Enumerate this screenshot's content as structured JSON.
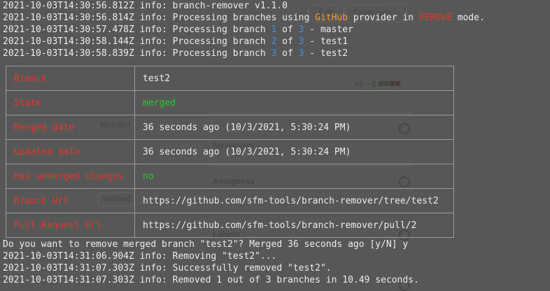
{
  "background_ui": {
    "edit": "Edit",
    "open_with": "Open with",
    "diff_added": "+2",
    "diff_removed": "−2",
    "member": "Member",
    "no_reviews": "No reviews",
    "assignees": "Assignees",
    "verified": "Verified",
    "labels": "Labels"
  },
  "log_lines": [
    {
      "ts": "2021-10-03T14:30:56.812Z",
      "prefix": " info: branch-remover v1.1.0"
    },
    {
      "ts": "2021-10-03T14:30:56.814Z",
      "prefix": " info: Processing branches using ",
      "provider": "GitHub",
      "mid": " provider in ",
      "mode": "REMOVE",
      "suffix": " mode."
    },
    {
      "ts": "2021-10-03T14:30:57.478Z",
      "prefix": " info: Processing branch ",
      "index": "1",
      "of": " of ",
      "total": "3",
      "suffix": " - master"
    },
    {
      "ts": "2021-10-03T14:30:58.144Z",
      "prefix": " info: Processing branch ",
      "index": "2",
      "of": " of ",
      "total": "3",
      "suffix": " - test1"
    },
    {
      "ts": "2021-10-03T14:30:58.839Z",
      "prefix": " info: Processing branch ",
      "index": "3",
      "of": " of ",
      "total": "3",
      "suffix": " - test2"
    }
  ],
  "branch_table": [
    {
      "key": "Branch",
      "value": "test2"
    },
    {
      "key": "State",
      "value": "merged"
    },
    {
      "key": "Merged date",
      "value": "36 seconds ago (10/3/2021, 5:30:24 PM)"
    },
    {
      "key": "Updated date",
      "value": "36 seconds ago (10/3/2021, 5:30:24 PM)"
    },
    {
      "key": "Has unmerged changes",
      "value": "no"
    },
    {
      "key": "Branch Url",
      "value": "https://github.com/sfm-tools/branch-remover/tree/test2"
    },
    {
      "key": "Pull Request Url",
      "value": "https://github.com/sfm-tools/branch-remover/pull/2"
    }
  ],
  "prompt": "Do you want to remove merged branch \"test2\"? Merged 36 seconds ago [y/N] y",
  "result_lines": [
    "2021-10-03T14:31:06.904Z info: Removing \"test2\"...",
    "2021-10-03T14:31:07.303Z info: Successfully removed \"test2\".",
    "2021-10-03T14:31:07.303Z info: Removed 1 out of 3 branches in 10.49 seconds."
  ],
  "colors": {
    "background": "#575757",
    "text": "#ececec",
    "key_red": "#e1362c",
    "provider_orange": "#ff9a2e",
    "number_blue": "#3b8eea",
    "state_green": "#2fc42f",
    "table_border": "#9b9b9b"
  }
}
